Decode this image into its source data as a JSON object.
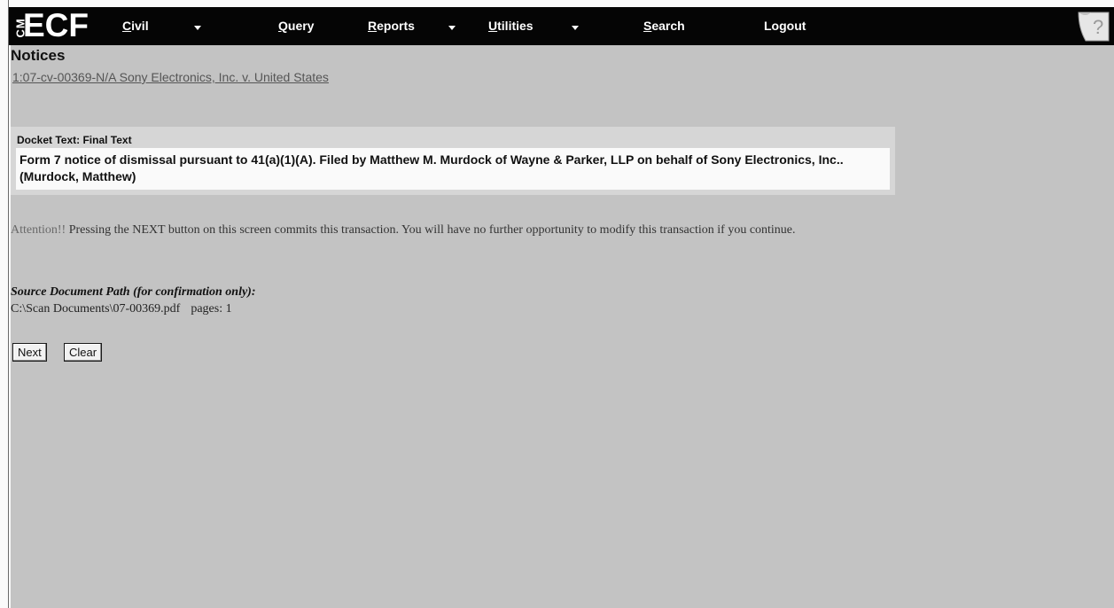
{
  "menubar": {
    "logo_cm": "CM",
    "logo_ecf": "ECF",
    "items": [
      {
        "first": "C",
        "rest": "ivil"
      },
      {
        "first": "Q",
        "rest": "uery"
      },
      {
        "first": "R",
        "rest": "eports"
      },
      {
        "first": "U",
        "rest": "tilities"
      },
      {
        "first": "S",
        "rest": "earch"
      },
      {
        "first": "",
        "rest": "Logout"
      }
    ],
    "help_glyph": "?"
  },
  "page": {
    "title": "Notices",
    "case_link": "1:07-cv-00369-N/A Sony Electronics, Inc. v. United States"
  },
  "docket": {
    "label": "Docket Text: Final Text",
    "text": "Form 7 notice of dismissal pursuant to 41(a)(1)(A). Filed by Matthew M. Murdock of Wayne & Parker, LLP on behalf of Sony Electronics, Inc..(Murdock, Matthew)"
  },
  "attention": {
    "word": "Attention!!",
    "message": " Pressing the NEXT button on this screen commits this transaction. You will have no further opportunity to modify this transaction if you continue."
  },
  "source": {
    "label": "Source Document Path (for confirmation only):",
    "path": "C:\\Scan Documents\\07-00369.pdf",
    "pages": "pages: 1"
  },
  "buttons": {
    "next_label": "Next",
    "clear_label": "Clear"
  },
  "colors": {
    "background": "#c3c3c3",
    "menubar": "#050505",
    "panel": "#d6d6d6",
    "docket_box": "#fafafa"
  }
}
